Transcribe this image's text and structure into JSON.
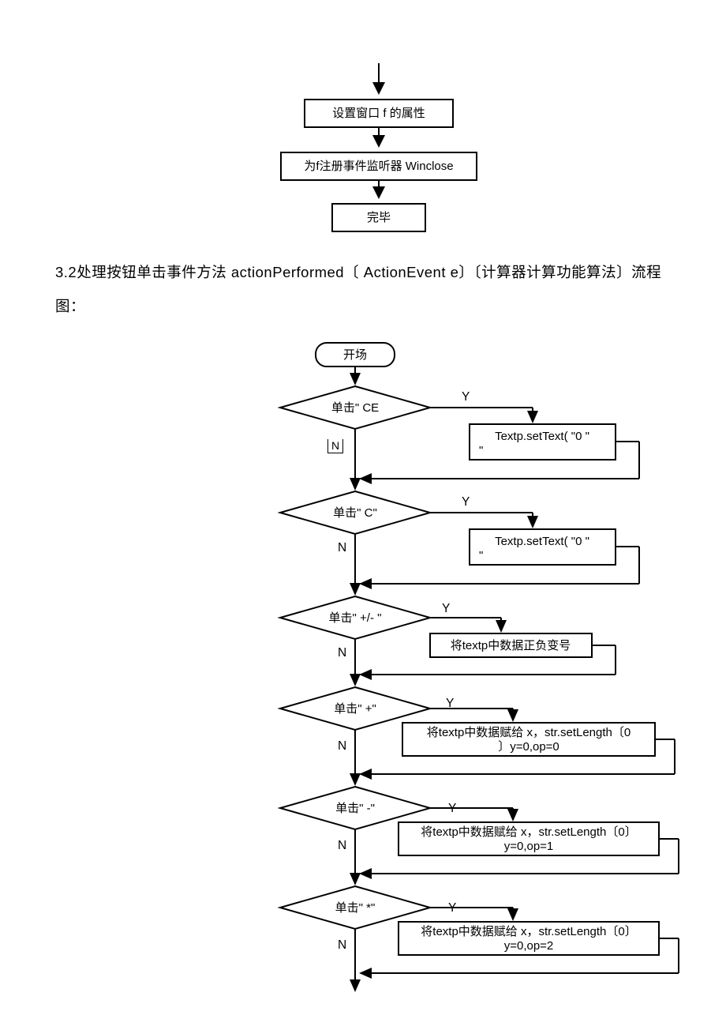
{
  "top_flow": {
    "b1": "设置窗口 f 的属性",
    "b2": "为f注册事件监听器  Winclose",
    "b3": "完毕"
  },
  "section_heading": "3.2处理按钮单击事件方法     actionPerformed〔 ActionEvent e〕〔计算器计算功能算法〕流程图：",
  "chart_data": {
    "type": "flowchart",
    "start": "开场",
    "steps": [
      {
        "decision": "单击\" CE \"",
        "yes_action": "Textp.setText( \"0\" ",
        "no_label": "N",
        "yes_label": "Y",
        "no_boxed": true
      },
      {
        "decision": "单击\" C\"",
        "yes_action": "Textp.setText( \"0\" ",
        "no_label": "N",
        "yes_label": "Y",
        "no_boxed": false
      },
      {
        "decision": "单击\" +/- \"",
        "yes_action": "将textp中数据正负变号",
        "no_label": "N",
        "yes_label": "Y",
        "no_boxed": false
      },
      {
        "decision": "单击\" +\"",
        "yes_action": "将textp中数据赋给 x，str.setLength〔0〕y=0,op=0",
        "no_label": "N",
        "yes_label": "Y",
        "no_boxed": false
      },
      {
        "decision": "单击\" -\"",
        "yes_action": "将textp中数据赋给 x，str.setLength〔0〕y=0,op=1",
        "no_label": "N",
        "yes_label": "Y",
        "no_boxed": false
      },
      {
        "decision": "单击\" *\"",
        "yes_action": "将textp中数据赋给 x，str.setLength〔0〕y=0,op=2",
        "no_label": "N",
        "yes_label": "Y",
        "no_boxed": false
      }
    ]
  },
  "flow": {
    "start": "开场",
    "d1": "单击\"  CE  ",
    "d1y": "Y",
    "d1n": "N",
    "a1": "Textp.setText( \"0 \"",
    "d2": "单击\"  C\"",
    "d2y": "Y",
    "d2n": "N",
    "a2": "Textp.setText( \"0 \"",
    "d3": "单击\"  +/-  \"",
    "d3y": "Y",
    "d3n": "N",
    "a3": "将textp中数据正负变号",
    "d4": "单击\"  +\"",
    "d4y": "Y",
    "d4n": "N",
    "a4a": "将textp中数据赋给 x，str.setLength〔0",
    "a4b": "〕y=0,op=0",
    "d5": "单击\" -\"",
    "d5y": "Y",
    "d5n": "N",
    "a5a": "将textp中数据赋给 x，str.setLength〔0〕",
    "a5b": "y=0,op=1",
    "d6": "单击\"  *\"",
    "d6y": "Y",
    "d6n": "N",
    "a6a": "将textp中数据赋给 x，str.setLength〔0〕",
    "a6b": "y=0,op=2"
  }
}
